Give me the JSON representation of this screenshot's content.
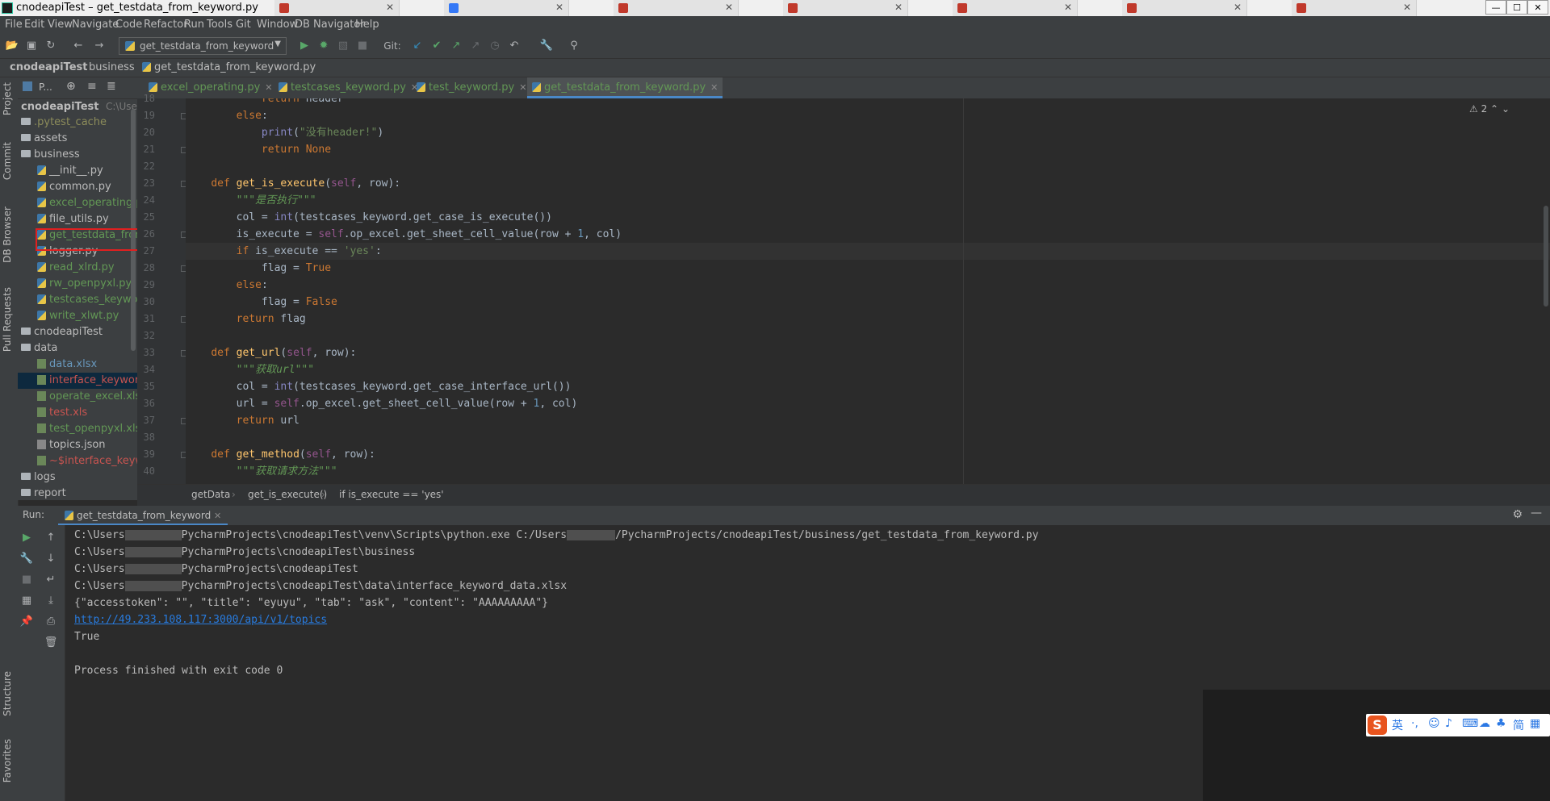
{
  "window": {
    "title": "cnodeapiTest – get_testdata_from_keyword.py",
    "browser_tabs": [
      {
        "label": "",
        "color": "#c0392b"
      },
      {
        "label": "",
        "color": "#3478f6"
      },
      {
        "label": "",
        "color": "#c0392b"
      },
      {
        "label": "",
        "color": "#c0392b"
      },
      {
        "label": "",
        "color": "#c0392b"
      },
      {
        "label": "",
        "color": "#c0392b"
      },
      {
        "label": "",
        "color": "#c0392b"
      }
    ],
    "controls": {
      "minimize": "—",
      "maximize": "☐",
      "close": "✕"
    }
  },
  "menubar": [
    "File",
    "Edit",
    "View",
    "Navigate",
    "Code",
    "Refactor",
    "Run",
    "Tools",
    "Git",
    "Window",
    "DB Navigator",
    "Help"
  ],
  "toolbar": {
    "run_config": "get_testdata_from_keyword",
    "git_label": "Git:"
  },
  "navbar": {
    "crumbs": [
      "cnodeapiTest",
      "business",
      "get_testdata_from_keyword.py"
    ]
  },
  "left_stripe": [
    "Project",
    "Commit",
    "DB Browser",
    "Pull Requests",
    "Structure",
    "Favorites"
  ],
  "project": {
    "header_label": "P...",
    "root_name": "cnodeapiTest",
    "root_path": "C:\\Users\\",
    "items": [
      {
        "label": ".pytest_cache",
        "kind": "folder",
        "color": "olive",
        "indent": 1
      },
      {
        "label": "assets",
        "kind": "folder",
        "color": "plain",
        "indent": 1
      },
      {
        "label": "business",
        "kind": "folder",
        "color": "plain",
        "indent": 1
      },
      {
        "label": "__init__.py",
        "kind": "py",
        "color": "plain",
        "indent": 2
      },
      {
        "label": "common.py",
        "kind": "py",
        "color": "plain",
        "indent": 2
      },
      {
        "label": "excel_operating.py",
        "kind": "py",
        "color": "green",
        "indent": 2
      },
      {
        "label": "file_utils.py",
        "kind": "py",
        "color": "plain",
        "indent": 2
      },
      {
        "label": "get_testdata_from_keyword.py",
        "kind": "py",
        "color": "green",
        "indent": 2
      },
      {
        "label": "logger.py",
        "kind": "py",
        "color": "plain",
        "indent": 2
      },
      {
        "label": "read_xlrd.py",
        "kind": "py",
        "color": "green",
        "indent": 2
      },
      {
        "label": "rw_openpyxl.py",
        "kind": "py",
        "color": "green",
        "indent": 2
      },
      {
        "label": "testcases_keyword.py",
        "kind": "py",
        "color": "green",
        "indent": 2
      },
      {
        "label": "write_xlwt.py",
        "kind": "py",
        "color": "green",
        "indent": 2
      },
      {
        "label": "cnodeapiTest",
        "kind": "folder",
        "color": "plain",
        "indent": 1
      },
      {
        "label": "data",
        "kind": "folder",
        "color": "plain",
        "indent": 1
      },
      {
        "label": "data.xlsx",
        "kind": "xl",
        "color": "blue",
        "indent": 2
      },
      {
        "label": "interface_keyword_data.xlsx",
        "kind": "xl",
        "color": "red",
        "indent": 2
      },
      {
        "label": "operate_excel.xlsx",
        "kind": "xl",
        "color": "green",
        "indent": 2
      },
      {
        "label": "test.xls",
        "kind": "xl",
        "color": "red",
        "indent": 2
      },
      {
        "label": "test_openpyxl.xlsx",
        "kind": "xl",
        "color": "green",
        "indent": 2
      },
      {
        "label": "topics.json",
        "kind": "json",
        "color": "plain",
        "indent": 2
      },
      {
        "label": "~$interface_keyword_data.xlsx",
        "kind": "xl",
        "color": "red",
        "indent": 2
      },
      {
        "label": "logs",
        "kind": "folder",
        "color": "plain",
        "indent": 1
      },
      {
        "label": "report",
        "kind": "folder",
        "color": "plain",
        "indent": 1
      }
    ],
    "selected_index": 16,
    "highlighted_index": 7
  },
  "editor": {
    "tabs": [
      {
        "label": "excel_operating.py",
        "active": false
      },
      {
        "label": "testcases_keyword.py",
        "active": false
      },
      {
        "label": "test_keyword.py",
        "active": false
      },
      {
        "label": "get_testdata_from_keyword.py",
        "active": true
      }
    ],
    "warnings": "⚠ 2",
    "first_line": 18,
    "current_line": 27,
    "lines": [
      [
        [
          "",
          "            "
        ],
        [
          "kw",
          "return "
        ],
        [
          "",
          "header"
        ]
      ],
      [
        [
          "",
          "        "
        ],
        [
          "kw",
          "else"
        ],
        [
          "",
          ":"
        ]
      ],
      [
        [
          "",
          "            "
        ],
        [
          "bi",
          "print"
        ],
        [
          "",
          "("
        ],
        [
          "st",
          "\"没有header!\""
        ],
        [
          "",
          ")"
        ]
      ],
      [
        [
          "",
          "            "
        ],
        [
          "kw",
          "return None"
        ]
      ],
      [
        [
          "",
          ""
        ]
      ],
      [
        [
          "",
          "    "
        ],
        [
          "kw",
          "def "
        ],
        [
          "fn",
          "get_is_execute"
        ],
        [
          "",
          "("
        ],
        [
          "sf",
          "self"
        ],
        [
          "",
          ", row):"
        ]
      ],
      [
        [
          "",
          "        "
        ],
        [
          "doc",
          "\"\"\"是否执行\"\"\""
        ]
      ],
      [
        [
          "",
          "        col = "
        ],
        [
          "bi",
          "int"
        ],
        [
          "",
          "(testcases_keyword.get_case_is_execute())"
        ]
      ],
      [
        [
          "",
          "        is_execute = "
        ],
        [
          "sf",
          "self"
        ],
        [
          "",
          ".op_excel.get_sheet_cell_value(row + "
        ],
        [
          "nm",
          "1"
        ],
        [
          "",
          ", col)"
        ]
      ],
      [
        [
          "",
          "        "
        ],
        [
          "kw",
          "if "
        ],
        [
          "",
          "is_execute == "
        ],
        [
          "st",
          "'yes'"
        ],
        [
          "",
          ":"
        ]
      ],
      [
        [
          "",
          "            flag = "
        ],
        [
          "kw",
          "True"
        ]
      ],
      [
        [
          "",
          "        "
        ],
        [
          "kw",
          "else"
        ],
        [
          "",
          ":"
        ]
      ],
      [
        [
          "",
          "            flag = "
        ],
        [
          "kw",
          "False"
        ]
      ],
      [
        [
          "",
          "        "
        ],
        [
          "kw",
          "return "
        ],
        [
          "",
          "flag"
        ]
      ],
      [
        [
          "",
          ""
        ]
      ],
      [
        [
          "",
          "    "
        ],
        [
          "kw",
          "def "
        ],
        [
          "fn",
          "get_url"
        ],
        [
          "",
          "("
        ],
        [
          "sf",
          "self"
        ],
        [
          "",
          ", row):"
        ]
      ],
      [
        [
          "",
          "        "
        ],
        [
          "doc",
          "\"\"\"获取url\"\"\""
        ]
      ],
      [
        [
          "",
          "        col = "
        ],
        [
          "bi",
          "int"
        ],
        [
          "",
          "(testcases_keyword.get_case_interface_url())"
        ]
      ],
      [
        [
          "",
          "        url = "
        ],
        [
          "sf",
          "self"
        ],
        [
          "",
          ".op_excel.get_sheet_cell_value(row + "
        ],
        [
          "nm",
          "1"
        ],
        [
          "",
          ", col)"
        ]
      ],
      [
        [
          "",
          "        "
        ],
        [
          "kw",
          "return "
        ],
        [
          "",
          "url"
        ]
      ],
      [
        [
          "",
          ""
        ]
      ],
      [
        [
          "",
          "    "
        ],
        [
          "kw",
          "def "
        ],
        [
          "fn",
          "get_method"
        ],
        [
          "",
          "("
        ],
        [
          "sf",
          "self"
        ],
        [
          "",
          ", row):"
        ]
      ],
      [
        [
          "",
          "        "
        ],
        [
          "doc",
          "\"\"\"获取请求方法\"\"\""
        ]
      ]
    ],
    "breadcrumbs": [
      "getData",
      "get_is_execute()",
      "if is_execute == 'yes'"
    ]
  },
  "run": {
    "label": "Run:",
    "tab": "get_testdata_from_keyword",
    "output": [
      {
        "parts": [
          "C:\\Users",
          "BLUR",
          "PycharmProjects\\cnodeapiTest\\venv\\Scripts\\python.exe C:/Users",
          "BLUR",
          "/PycharmProjects/cnodeapiTest/business/get_testdata_from_keyword.py"
        ]
      },
      {
        "parts": [
          "C:\\Users",
          "BLUR",
          "PycharmProjects\\cnodeapiTest\\business"
        ]
      },
      {
        "parts": [
          "C:\\Users",
          "BLUR",
          "PycharmProjects\\cnodeapiTest"
        ]
      },
      {
        "parts": [
          "C:\\Users",
          "BLUR",
          "PycharmProjects\\cnodeapiTest\\data\\interface_keyword_data.xlsx"
        ]
      },
      {
        "parts": [
          "{\"accesstoken\": \"\", \"title\": \"eyuyu\", \"tab\": \"ask\", \"content\": \"AAAAAAAAA\"}"
        ]
      },
      {
        "link": "http://49.233.108.117:3000/api/v1/topics"
      },
      {
        "parts": [
          "True"
        ]
      },
      {
        "parts": [
          ""
        ]
      },
      {
        "parts": [
          "Process finished with exit code 0"
        ]
      }
    ]
  },
  "ime": {
    "logo": "S",
    "mode": "英",
    "items": [
      "·,",
      "☺",
      "♪",
      "⌨",
      "☁",
      "♣",
      "简",
      "▦"
    ]
  }
}
